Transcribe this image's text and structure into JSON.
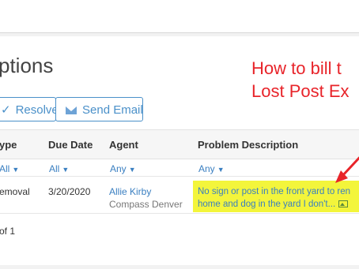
{
  "page": {
    "title": "ptions"
  },
  "toolbar": {
    "resolve_label": "Resolve",
    "email_label": "Send Email"
  },
  "table": {
    "headers": [
      "ype",
      "Due Date",
      "Agent",
      "Problem Description"
    ],
    "filters": [
      "All",
      "All",
      "Any",
      "Any"
    ],
    "rows": [
      {
        "type": "emoval",
        "due_date": "3/20/2020",
        "agent_name": "Allie Kirby",
        "agent_company": "Compass Denver",
        "description_line1": "No sign or post in the front yard to ren",
        "description_line2": "home and dog in the yard I don't..."
      }
    ],
    "pager": "of 1"
  },
  "annotation": {
    "line1": "How to bill t",
    "line2": "Lost Post Ex"
  },
  "colors": {
    "accent": "#3a7fc1",
    "highlight": "#f3f53b",
    "annotation": "#e8242a"
  },
  "icons": {
    "resolve": "check-icon",
    "email": "envelope-icon",
    "filter": "filter-icon",
    "attachment": "image-icon"
  }
}
